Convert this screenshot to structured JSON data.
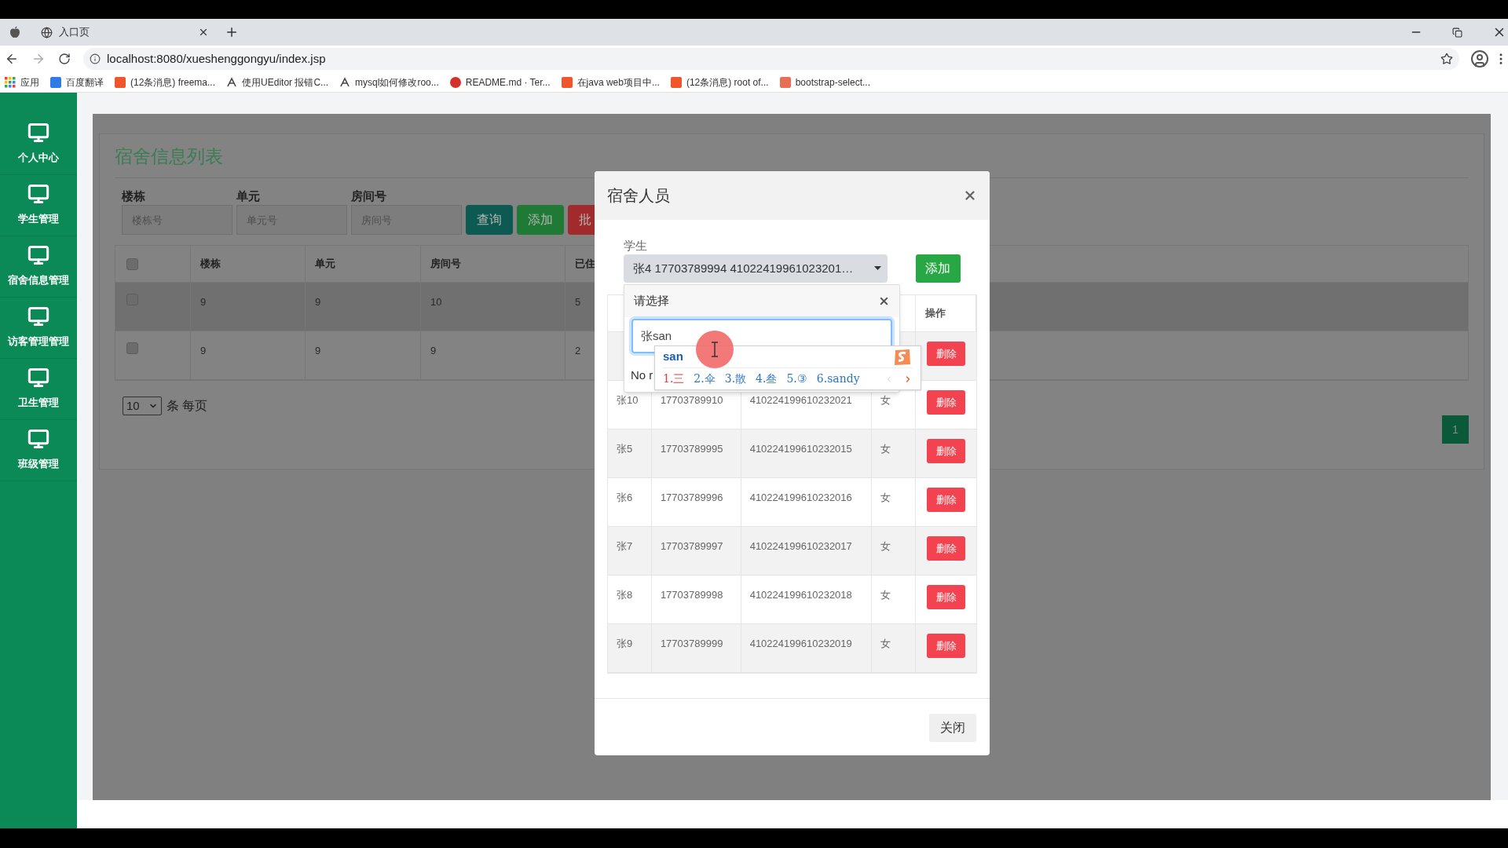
{
  "browser": {
    "tab": {
      "title": "入口页"
    },
    "address": "localhost:8080/xueshenggongyu/index.jsp",
    "bookmarks": [
      {
        "label": "应用",
        "kind": "apps"
      },
      {
        "label": "百度翻译",
        "kind": "translate"
      },
      {
        "label": "(12条消息) freema...",
        "kind": "csdn"
      },
      {
        "label": "使用UEditor 报错C...",
        "kind": "feather"
      },
      {
        "label": "mysql如何修改roo...",
        "kind": "feather"
      },
      {
        "label": "README.md · Ter...",
        "kind": "gitee"
      },
      {
        "label": "在java web项目中...",
        "kind": "csdn"
      },
      {
        "label": "(12条消息) root of...",
        "kind": "csdn"
      },
      {
        "label": "bootstrap-select...",
        "kind": "jianshu"
      }
    ]
  },
  "sidebar": {
    "items": [
      {
        "label": "个人中心"
      },
      {
        "label": "学生管理"
      },
      {
        "label": "宿舍信息管理"
      },
      {
        "label": "访客管理管理"
      },
      {
        "label": "卫生管理"
      },
      {
        "label": "班级管理"
      }
    ]
  },
  "page": {
    "title": "宿舍信息列表",
    "filters": [
      {
        "label": "楼栋",
        "placeholder": "楼栋号"
      },
      {
        "label": "单元",
        "placeholder": "单元号"
      },
      {
        "label": "房间号",
        "placeholder": "房间号"
      }
    ],
    "buttons": [
      {
        "label": "查询",
        "kind": "query"
      },
      {
        "label": "添加",
        "kind": "add"
      },
      {
        "label": "批",
        "kind": "batch"
      }
    ],
    "table": {
      "all_checked": false,
      "columns": [
        "楼栋",
        "单元",
        "房间号",
        "已住"
      ],
      "rows": [
        {
          "cells": [
            "9",
            "9",
            "10",
            "5"
          ],
          "hovered": true,
          "checked": false
        },
        {
          "cells": [
            "9",
            "9",
            "9",
            "2"
          ],
          "hovered": false,
          "checked": false
        }
      ]
    },
    "page_size": "10",
    "page_size_label": "条 每页",
    "pages": [
      {
        "label": "1",
        "selected": true
      }
    ]
  },
  "modal": {
    "title": "宿舍人员",
    "student_label": "学生",
    "student_value": "张4 17703789994 41022419961023201…",
    "add_button": "添加",
    "action_column": "操作",
    "rows": [
      {
        "action": "删除"
      },
      {
        "name": "张10",
        "phone": "17703789910",
        "id_number": "410224199610232021",
        "gender": "女",
        "action": "删除"
      },
      {
        "name": "张5",
        "phone": "17703789995",
        "id_number": "410224199610232015",
        "gender": "女",
        "action": "删除"
      },
      {
        "name": "张6",
        "phone": "17703789996",
        "id_number": "410224199610232016",
        "gender": "女",
        "action": "删除"
      },
      {
        "name": "张7",
        "phone": "17703789997",
        "id_number": "410224199610232017",
        "gender": "女",
        "action": "删除"
      },
      {
        "name": "张8",
        "phone": "17703789998",
        "id_number": "410224199610232018",
        "gender": "女",
        "action": "删除"
      },
      {
        "name": "张9",
        "phone": "17703789999",
        "id_number": "410224199610232019",
        "gender": "女",
        "action": "删除"
      }
    ],
    "dropdown": {
      "title": "请选择",
      "search_value": "张san",
      "no_results": "No r"
    },
    "ime": {
      "composition": "san",
      "candidates": [
        {
          "label": "1.三",
          "selected": true
        },
        {
          "label": "2.伞",
          "selected": false
        },
        {
          "label": "3.散",
          "selected": false
        },
        {
          "label": "4.叁",
          "selected": false
        },
        {
          "label": "5.③",
          "selected": false
        },
        {
          "label": "6.sandy",
          "selected": false
        }
      ]
    },
    "close_button": "关闭"
  }
}
